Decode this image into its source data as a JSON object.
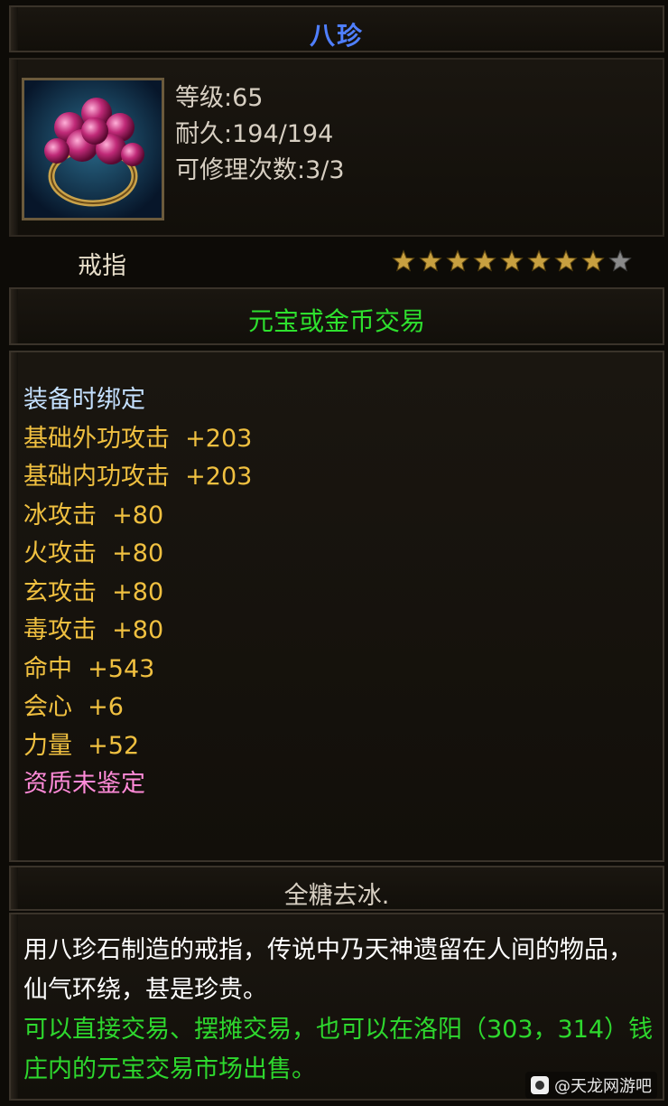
{
  "item": {
    "name": "八珍",
    "level": "等级:65",
    "durability": "耐久:194/194",
    "repair_count": "可修理次数:3/3",
    "type": "戒指",
    "stars_filled": 8,
    "stars_total": 9,
    "trade": "元宝或金币交易"
  },
  "attributes": [
    {
      "text": "装备时绑定",
      "color": "blue"
    },
    {
      "text": "基础外功攻击  +203",
      "color": "gold"
    },
    {
      "text": "基础内功攻击  +203",
      "color": "gold"
    },
    {
      "text": "冰攻击  +80",
      "color": "gold"
    },
    {
      "text": "火攻击  +80",
      "color": "gold"
    },
    {
      "text": "玄攻击  +80",
      "color": "gold"
    },
    {
      "text": "毒攻击  +80",
      "color": "gold"
    },
    {
      "text": "命中  +543",
      "color": "gold"
    },
    {
      "text": "会心  +6",
      "color": "gold"
    },
    {
      "text": "力量  +52",
      "color": "gold"
    },
    {
      "text": "资质未鉴定",
      "color": "pink"
    }
  ],
  "set_label": "全糖去冰.",
  "description": {
    "white": "用八珍石制造的戒指，传说中乃天神遗留在人间的物品，仙气环绕，甚是珍贵。",
    "green": "可以直接交易、摆摊交易，也可以在洛阳（303，314）钱庄内的元宝交易市场出售。"
  },
  "watermark": "@天龙网游吧",
  "colors": {
    "title": "#4f7fff",
    "trade": "#2ee02e",
    "gold_attr": "#f0c040",
    "bind": "#c4e0ff",
    "aptitude": "#ff8ad8",
    "star_on": "#c8a040",
    "star_off": "#8a8a8a"
  },
  "icons": {
    "item_icon": "ring-icon",
    "star": "star-icon",
    "watermark": "app-logo-icon"
  }
}
